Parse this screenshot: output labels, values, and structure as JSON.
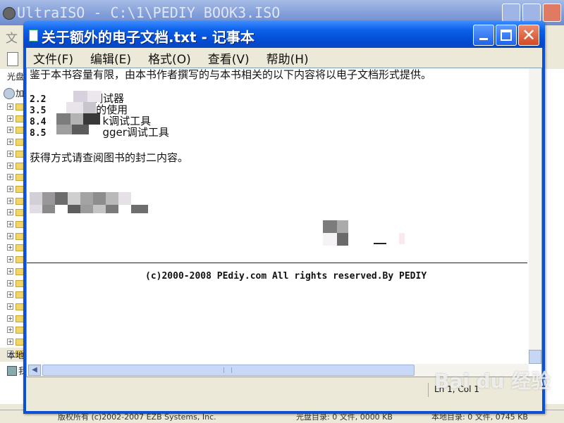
{
  "bg_window": {
    "title": "UltraISO - C:\\1\\PEDIY BOOK3.ISO",
    "menu_partial": "文",
    "pane_label": "光盘",
    "root_partial": "加",
    "local_label": "本地",
    "local_item": "我",
    "status_left": "版权所有 (c)2002-2007 EZB Systems, Inc.",
    "status_mid": "光盘目录: 0 文件, 0000 KB",
    "status_right": "本地目录: 0 文件, 0745 KB"
  },
  "notepad": {
    "title": "关于额外的电子文档.txt - 记事本",
    "menu": [
      "文件(F)",
      "编辑(E)",
      "格式(O)",
      "查看(V)",
      "帮助(H)"
    ],
    "lines": {
      "intro": "鉴于本书容量有限，由本书作者撰写的与本书相关的以下内容将以电子文档形式提供。",
      "item1_num": "2.2",
      "item1_tail": "E调试器",
      "item2_num": "3.5",
      "item2_tail": "m的使用",
      "item3_num": "8.4",
      "item3_tail": "k调试工具",
      "item4_num": "8.5",
      "item4_tail": "gger调试工具",
      "access": "获得方式请查阅图书的封二内容。"
    },
    "footer": "(c)2000-2008 PEdiy.com All rights reserved.By PEDIY",
    "status": "Ln 1, Col 1"
  },
  "watermark": "Bai du 经验",
  "colors": {
    "titlebar": "#0a5fe8",
    "close_button": "#d24a23",
    "chrome": "#ece9d8"
  }
}
